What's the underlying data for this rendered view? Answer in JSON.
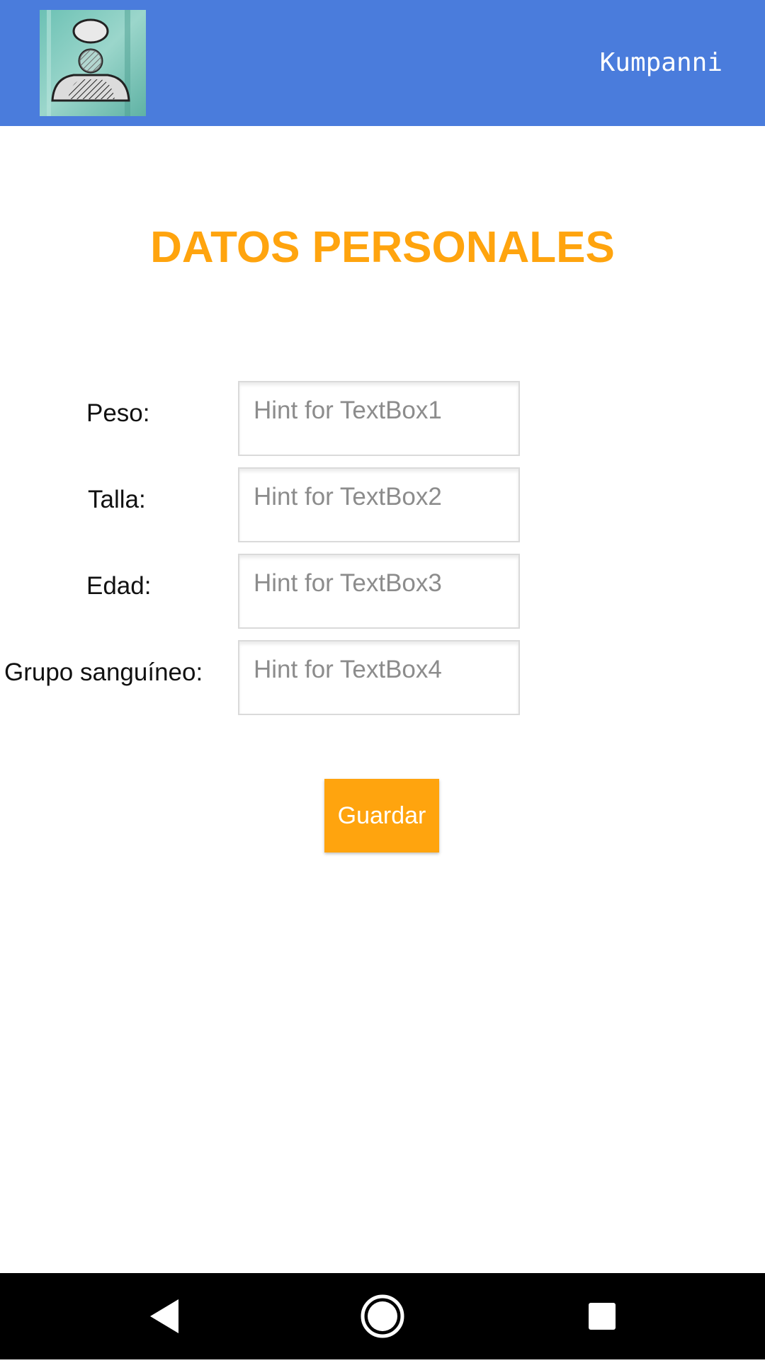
{
  "app_bar": {
    "title": "Kumpanni",
    "logo_icon": "person-sketch-logo-icon",
    "background_color": "#4a7cdc"
  },
  "main": {
    "page_title": "DATOS PERSONALES",
    "title_color": "#ffa40e",
    "fields": [
      {
        "label": "Peso:",
        "placeholder": "Hint for TextBox1",
        "value": ""
      },
      {
        "label": "Talla:",
        "placeholder": "Hint for TextBox2",
        "value": ""
      },
      {
        "label": "Edad:",
        "placeholder": "Hint for TextBox3",
        "value": ""
      },
      {
        "label": "Grupo sanguíneo:",
        "placeholder": "Hint for TextBox4",
        "value": ""
      }
    ],
    "save_label": "Guardar",
    "save_color": "#ffa40e"
  },
  "nav_bar": {
    "back_icon": "back-triangle-icon",
    "home_icon": "home-circle-icon",
    "recents_icon": "recents-square-icon"
  }
}
